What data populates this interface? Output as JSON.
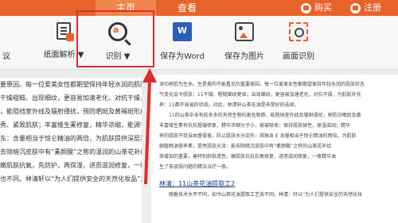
{
  "topbar": {
    "tabs": [
      {
        "label": "主页"
      },
      {
        "label": "查看"
      }
    ],
    "buy_label": "购买",
    "register_label": "注册"
  },
  "ribbon": {
    "left_partial_label": "议",
    "buttons": [
      {
        "label": "纸面解析 ▼",
        "icon": "document-parse-icon"
      },
      {
        "label": "识别 ▼",
        "icon": "ocr-magnifier-icon",
        "icon_letter": "a"
      },
      {
        "label": "保存为Word",
        "icon": "word-icon",
        "icon_letter": "W"
      },
      {
        "label": "保存为图片",
        "icon": "image-icon"
      },
      {
        "label": "画面识别",
        "icon": "screen-capture-icon"
      }
    ]
  },
  "left_page": {
    "lines": [
      "要原因。每一位爱美女性都期望保持年轻水润的肌肤状态，但天",
      "干燥粗糙、出现细纹，更容易加速老化，对抗干燥，为肌肤补充营",
      "",
      "，能阻挡室外线及辐射侵扰，预防晒斑及黄褐斑形成；内含精质",
      "秀、紧致肌肤；丰富维生素修复，精华浓缩，能调节肌肤弹性，保",
      "东：含量相当于惊仑精油的两倍，为肌肤提供深层滋润，加",
      "去除暗沉皮肤中有“素颜酸”之称的温润的山茶花补给营养。",
      "嫩肌肤抗氧，先防护，再保湿，进而滋润修复，一瓶精",
      "",
      "",
      "也不同。林清轩以“为人们提供安全的天然化妆品”为使命，从"
    ]
  },
  "right_page": {
    "lines": [
      "深切地慰为生命。生是美的不能看见的重要原因。每一位爱美女性都期望保持年轻水润的肌肤状态",
      "气变化会令肌肤：11干燥、粗糙细纹更显；出现细纹，更容易加速老化，对抗干燥，为肌肤补充",
      "养：11都不容易的功效。对此，林清轩山茶花油是非常好的选择。",
      "11的山茶中含有的多多的天然生物抗氧化物质，能阻挡室外线及辐射侵扰，预防日晒斑及黄",
      "丰富维生素有抗抗粗皱修复，精华浓缩分子小，易被吸收：保持肌肤弹性，保湿滋润；精华",
      "养的肌肤不受自由基侵害，防止肌肤水分流失：其独含 E 含量相当于惊仑精油的两倍，为肌肤",
      "细植物油营养素，提亮肌肤光泽：能去除暗沉皮肤中有“素颜酸”之称的山茶花补给",
      "渐增加的重要，善特别舒肤透性，嫩肌肤抗抗抗氧修复，进而滋润修复，一瓶精华油",
      "生了非皮肤问题的精法治疗一般。"
    ],
    "heading": "林清：11山茶花油提取工2",
    "last_line": "随着技术水平不同，如今山茶花油提取工艺各不同。林清：轩以“为人们提供安全的天然化妆"
  }
}
